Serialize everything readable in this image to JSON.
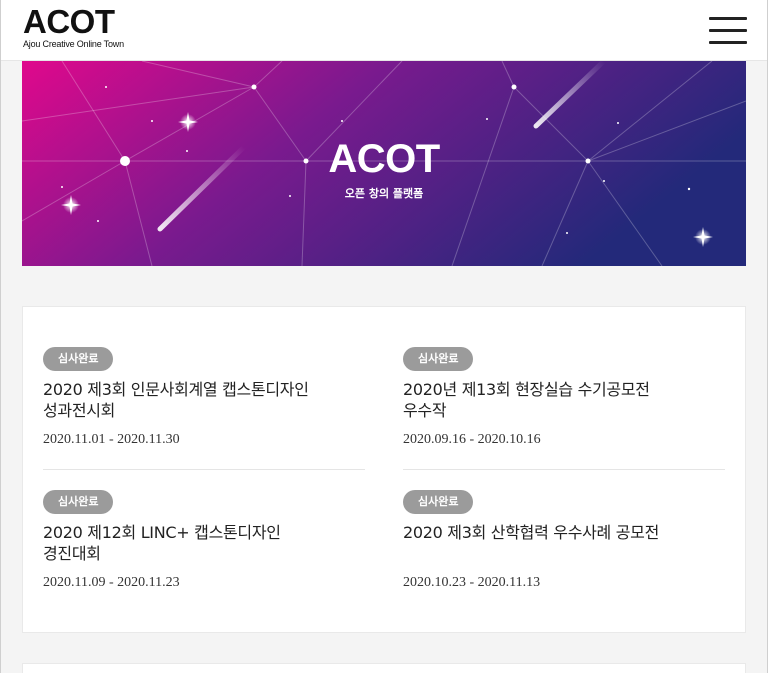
{
  "header": {
    "logo": "ACOT",
    "logo_sub": "Ajou Creative Online Town"
  },
  "banner": {
    "title": "ACOT",
    "subtitle": "오픈 창의 플랫폼",
    "gradient_start": "#e0088c",
    "gradient_end": "#23297a"
  },
  "items": [
    {
      "badge": "심사완료",
      "title_line1": "2020 제3회 인문사회계열 캡스톤디자인",
      "title_line2": "성과전시회",
      "date_start": "2020.11.01",
      "date_sep": " - ",
      "date_end": "2020.11.30"
    },
    {
      "badge": "심사완료",
      "title_line1": "2020년 제13회 현장실습 수기공모전",
      "title_line2": "우수작",
      "date_start": "2020.09.16",
      "date_sep": " - ",
      "date_end": "2020.10.16"
    },
    {
      "badge": "심사완료",
      "title_line1": "2020 제12회 LINC+ 캡스톤디자인",
      "title_line2": "경진대회",
      "date_start": "2020.11.09",
      "date_sep": " - ",
      "date_end": "2020.11.23"
    },
    {
      "badge": "심사완료",
      "title_line1": "2020 제3회 산학협력 우수사례 공모전",
      "title_line2": "",
      "date_start": "2020.10.23",
      "date_sep": " - ",
      "date_end": "2020.11.13"
    }
  ],
  "colors": {
    "badge": "#9b9b9b",
    "background": "#f4f4f4"
  }
}
